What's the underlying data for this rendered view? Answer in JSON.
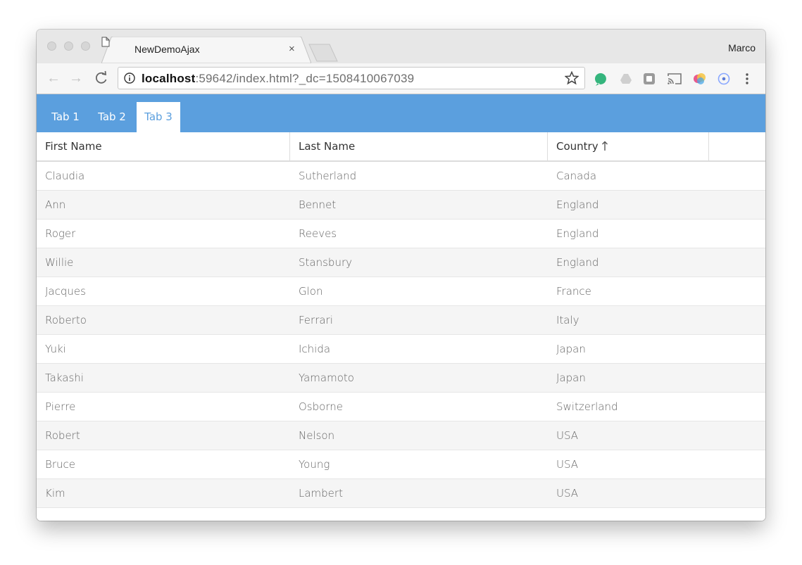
{
  "browser": {
    "tab_title": "NewDemoAjax",
    "tab_close": "×",
    "profile_name": "Marco",
    "url_host": "localhost",
    "url_rest": ":59642/index.html?_dc=1508410067039"
  },
  "app": {
    "accent_color": "#5b9fde",
    "tabs": [
      {
        "label": "Tab 1",
        "active": false
      },
      {
        "label": "Tab 2",
        "active": false
      },
      {
        "label": "Tab 3",
        "active": true
      }
    ]
  },
  "grid": {
    "columns": [
      "First Name",
      "Last Name",
      "Country"
    ],
    "sorted_column": "Country",
    "sort_direction": "ascending",
    "rows": [
      [
        "Claudia",
        "Sutherland",
        "Canada"
      ],
      [
        "Ann",
        "Bennet",
        "England"
      ],
      [
        "Roger",
        "Reeves",
        "England"
      ],
      [
        "Willie",
        "Stansbury",
        "England"
      ],
      [
        "Jacques",
        "Glon",
        "France"
      ],
      [
        "Roberto",
        "Ferrari",
        "Italy"
      ],
      [
        "Yuki",
        "Ichida",
        "Japan"
      ],
      [
        "Takashi",
        "Yamamoto",
        "Japan"
      ],
      [
        "Pierre",
        "Osborne",
        "Switzerland"
      ],
      [
        "Robert",
        "Nelson",
        "USA"
      ],
      [
        "Bruce",
        "Young",
        "USA"
      ],
      [
        "Kim",
        "Lambert",
        "USA"
      ]
    ]
  }
}
